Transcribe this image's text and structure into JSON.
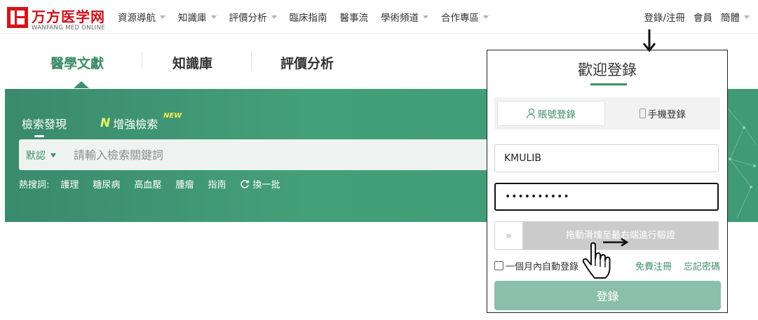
{
  "logo": {
    "cn": "万方医学网",
    "en": "WANFANG MED ONLINE"
  },
  "nav": {
    "items": [
      {
        "label": "資源導航",
        "dropdown": true
      },
      {
        "label": "知識庫",
        "dropdown": true
      },
      {
        "label": "評價分析",
        "dropdown": true
      },
      {
        "label": "臨床指南",
        "dropdown": false
      },
      {
        "label": "醫事流",
        "dropdown": false
      },
      {
        "label": "學術頻道",
        "dropdown": true
      },
      {
        "label": "合作專區",
        "dropdown": true
      }
    ],
    "login_register": "登錄/注冊",
    "member": "會員",
    "language": "簡體"
  },
  "main_tabs": [
    "醫學文獻",
    "知識庫",
    "評價分析"
  ],
  "search": {
    "tabs": [
      "檢索發現",
      "增強檢索"
    ],
    "new_badge": "NEW",
    "scope": "默認",
    "placeholder": "請輸入檢索關鍵詞",
    "hot_label": "熱搜詞:",
    "hot_words": [
      "護理",
      "糖尿病",
      "高血壓",
      "腫瘤",
      "指南"
    ],
    "refresh": "換一批"
  },
  "login": {
    "title": "歡迎登錄",
    "tabs": [
      "賬號登錄",
      "手機登錄"
    ],
    "username": "KMULIB",
    "password": "••••••••••",
    "slider_arrow": "»",
    "slider_text": "拖動滑塊至最右端進行驗證",
    "remember": "一個月內自動登錄",
    "register": "免費注冊",
    "forgot": "忘記密碼",
    "submit": "登錄"
  },
  "colors": {
    "brand_red": "#d9121a",
    "brand_green": "#3d8d67",
    "hero_green": "#429d77",
    "login_button": "#8abfab"
  }
}
